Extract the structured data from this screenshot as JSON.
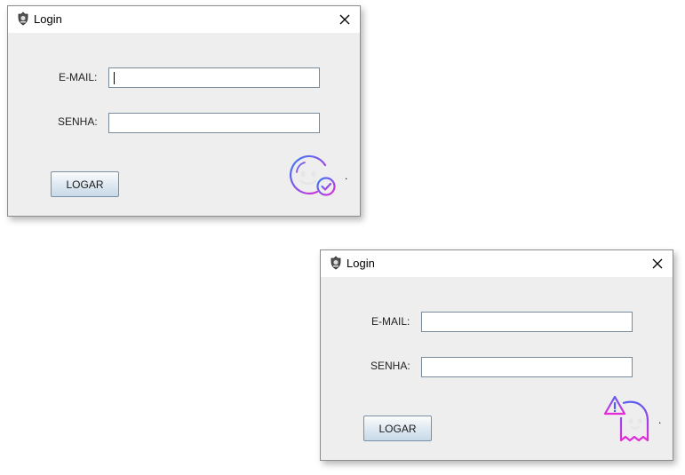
{
  "windows": [
    {
      "title": "Login",
      "email_label": "E-MAIL:",
      "password_label": "SENHA:",
      "email_value": "",
      "password_value": "",
      "button_label": "LOGAR",
      "status_icon": "smiley-check-icon",
      "status_text": "."
    },
    {
      "title": "Login",
      "email_label": "E-MAIL:",
      "password_label": "SENHA:",
      "email_value": "",
      "password_value": "",
      "button_label": "LOGAR",
      "status_icon": "ghost-warning-icon",
      "status_text": "."
    }
  ],
  "colors": {
    "icon_gradient_start": "#2f7cf6",
    "icon_gradient_end": "#e62ad6",
    "button_border": "#7a8ea6",
    "window_background": "#eeeeee"
  }
}
